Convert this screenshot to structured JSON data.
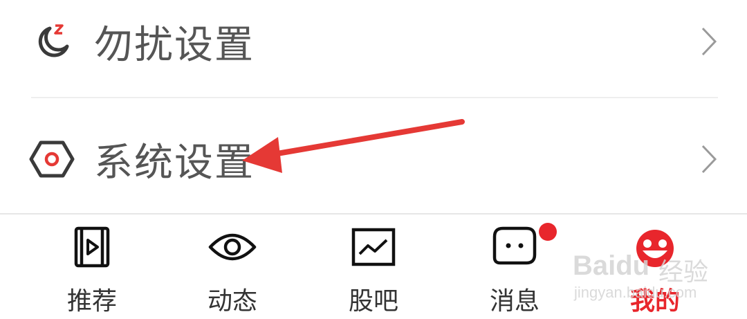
{
  "settings": {
    "items": [
      {
        "label": "勿扰设置",
        "icon": "moon-zzz-icon"
      },
      {
        "label": "系统设置",
        "icon": "hexagon-gear-icon"
      }
    ]
  },
  "tabbar": {
    "tabs": [
      {
        "label": "推荐",
        "icon": "play-cards-icon",
        "active": false
      },
      {
        "label": "动态",
        "icon": "eye-icon",
        "active": false
      },
      {
        "label": "股吧",
        "icon": "stock-chart-icon",
        "active": false
      },
      {
        "label": "消息",
        "icon": "chat-bubble-icon",
        "active": false,
        "badge": true
      },
      {
        "label": "我的",
        "icon": "smiley-avatar-icon",
        "active": true
      }
    ]
  },
  "watermark": {
    "brand": "Baidu",
    "cn": "经验",
    "sub": "jingyan.baidu.com"
  },
  "colors": {
    "accent": "#e8262c",
    "icon_red": "#e53935",
    "text": "#555555",
    "divider": "#eeeeee"
  }
}
